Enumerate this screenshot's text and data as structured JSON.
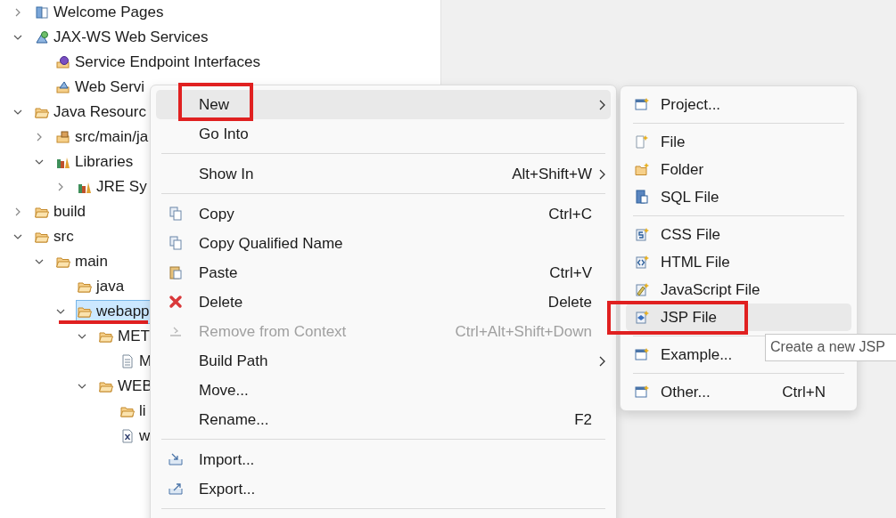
{
  "tree": [
    {
      "label": "Welcome Pages",
      "expanded": false,
      "selected": false,
      "annotated": false
    },
    {
      "label": "JAX-WS Web Services",
      "expanded": true,
      "selected": false,
      "annotated": false,
      "children": [
        {
          "label": "Service Endpoint Interfaces",
          "selected": false,
          "annotated": false
        },
        {
          "label": "Web Servi",
          "selected": false,
          "annotated": false
        }
      ]
    },
    {
      "label": "Java Resourc",
      "expanded": true,
      "selected": false,
      "annotated": false,
      "children": [
        {
          "label": "src/main/ja",
          "expanded": false,
          "selected": false,
          "annotated": false
        },
        {
          "label": "Libraries",
          "expanded": true,
          "selected": false,
          "annotated": false,
          "children": [
            {
              "label": "JRE Sy",
              "expanded": false,
              "selected": false,
              "annotated": false
            }
          ]
        }
      ]
    },
    {
      "label": "build",
      "expanded": false,
      "selected": false,
      "annotated": false
    },
    {
      "label": "src",
      "expanded": true,
      "selected": false,
      "annotated": false,
      "children": [
        {
          "label": "main",
          "expanded": true,
          "selected": false,
          "annotated": false,
          "children": [
            {
              "label": "java",
              "selected": false,
              "annotated": false
            },
            {
              "label": "webapp",
              "expanded": true,
              "selected": true,
              "annotated": true,
              "children": [
                {
                  "label": "MET",
                  "expanded": true,
                  "selected": false,
                  "annotated": false,
                  "children": [
                    {
                      "label": "M",
                      "selected": false,
                      "annotated": false
                    }
                  ]
                },
                {
                  "label": "WEB",
                  "expanded": true,
                  "selected": false,
                  "annotated": false,
                  "children": [
                    {
                      "label": "li",
                      "selected": false,
                      "annotated": false
                    },
                    {
                      "label": "w",
                      "selected": false,
                      "annotated": false
                    }
                  ]
                }
              ]
            }
          ]
        }
      ]
    }
  ],
  "context_menu": [
    {
      "kind": "item",
      "label": "New",
      "submenu": true,
      "selected": true,
      "annotated": true,
      "disabled": false
    },
    {
      "kind": "item",
      "label": "Go Into",
      "submenu": false,
      "selected": false,
      "annotated": false,
      "disabled": false
    },
    {
      "kind": "separator"
    },
    {
      "kind": "item",
      "label": "Show In",
      "shortcut": "Alt+Shift+W",
      "submenu": true,
      "selected": false,
      "annotated": false,
      "disabled": false
    },
    {
      "kind": "separator"
    },
    {
      "kind": "item",
      "label": "Copy",
      "shortcut": "Ctrl+C",
      "submenu": false,
      "selected": false,
      "annotated": false,
      "disabled": false
    },
    {
      "kind": "item",
      "label": "Copy Qualified Name",
      "submenu": false,
      "selected": false,
      "annotated": false,
      "disabled": false
    },
    {
      "kind": "item",
      "label": "Paste",
      "shortcut": "Ctrl+V",
      "submenu": false,
      "selected": false,
      "annotated": false,
      "disabled": false
    },
    {
      "kind": "item",
      "label": "Delete",
      "shortcut": "Delete",
      "submenu": false,
      "selected": false,
      "annotated": false,
      "disabled": false
    },
    {
      "kind": "item",
      "label": "Remove from Context",
      "shortcut": "Ctrl+Alt+Shift+Down",
      "submenu": false,
      "selected": false,
      "annotated": false,
      "disabled": true
    },
    {
      "kind": "item",
      "label": "Build Path",
      "submenu": true,
      "selected": false,
      "annotated": false,
      "disabled": false
    },
    {
      "kind": "item",
      "label": "Move...",
      "submenu": false,
      "selected": false,
      "annotated": false,
      "disabled": false
    },
    {
      "kind": "item",
      "label": "Rename...",
      "shortcut": "F2",
      "submenu": false,
      "selected": false,
      "annotated": false,
      "disabled": false
    },
    {
      "kind": "separator"
    },
    {
      "kind": "item",
      "label": "Import...",
      "submenu": false,
      "selected": false,
      "annotated": false,
      "disabled": false
    },
    {
      "kind": "item",
      "label": "Export...",
      "submenu": false,
      "selected": false,
      "annotated": false,
      "disabled": false
    },
    {
      "kind": "separator"
    }
  ],
  "new_submenu": [
    {
      "kind": "item",
      "label": "Project...",
      "selected": false,
      "annotated": false
    },
    {
      "kind": "separator"
    },
    {
      "kind": "item",
      "label": "File",
      "selected": false,
      "annotated": false
    },
    {
      "kind": "item",
      "label": "Folder",
      "selected": false,
      "annotated": false
    },
    {
      "kind": "item",
      "label": "SQL File",
      "selected": false,
      "annotated": false
    },
    {
      "kind": "separator"
    },
    {
      "kind": "item",
      "label": "CSS File",
      "selected": false,
      "annotated": false
    },
    {
      "kind": "item",
      "label": "HTML File",
      "selected": false,
      "annotated": false
    },
    {
      "kind": "item",
      "label": "JavaScript File",
      "selected": false,
      "annotated": false
    },
    {
      "kind": "item",
      "label": "JSP File",
      "selected": true,
      "annotated": true
    },
    {
      "kind": "separator"
    },
    {
      "kind": "item",
      "label": "Example...",
      "selected": false,
      "annotated": false
    },
    {
      "kind": "separator"
    },
    {
      "kind": "item",
      "label": "Other...",
      "shortcut": "Ctrl+N",
      "selected": false,
      "annotated": false
    }
  ],
  "tooltip": {
    "text": "Create a new JSP"
  }
}
